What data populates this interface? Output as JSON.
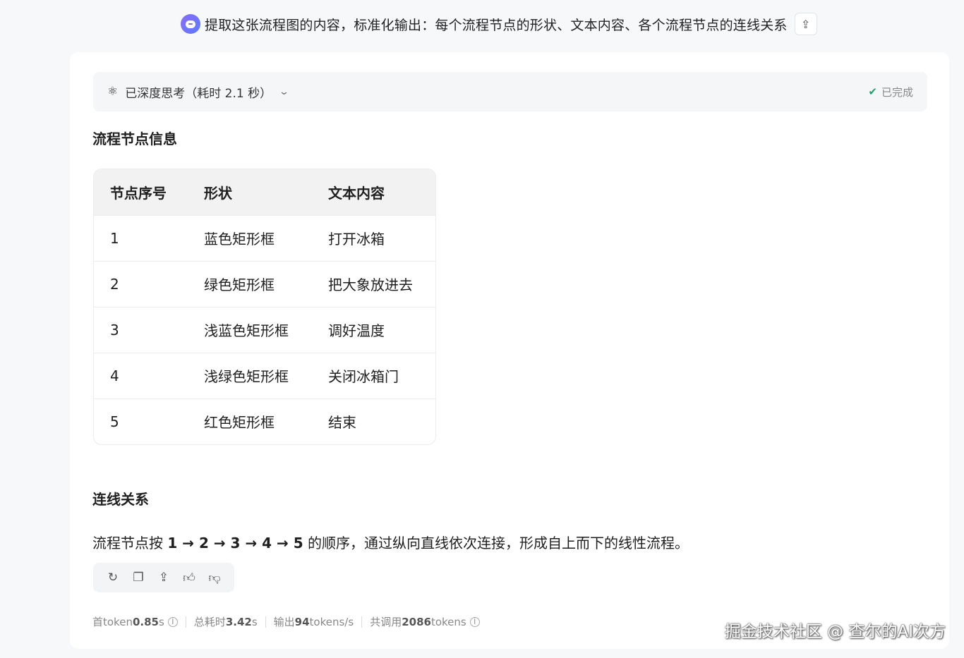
{
  "user_message": {
    "text": "提取这张流程图的内容，标准化输出：每个流程节点的形状、文本内容、各个流程节点的连线关系",
    "avatar_icon": "chat-bubble-icon",
    "share_icon": "share-icon"
  },
  "thinking": {
    "label": "已深度思考（耗时 2.1 秒）",
    "status": "已完成",
    "status_color": "#22a06b"
  },
  "nodes_section": {
    "title": "流程节点信息",
    "columns": [
      "节点序号",
      "形状",
      "文本内容"
    ],
    "rows": [
      [
        "1",
        "蓝色矩形框",
        "打开冰箱"
      ],
      [
        "2",
        "绿色矩形框",
        "把大象放进去"
      ],
      [
        "3",
        "浅蓝色矩形框",
        "调好温度"
      ],
      [
        "4",
        "浅绿色矩形框",
        "关闭冰箱门"
      ],
      [
        "5",
        "红色矩形框",
        "结束"
      ]
    ]
  },
  "links_section": {
    "title": "连线关系",
    "prefix": "流程节点按 ",
    "sequence": "1 → 2 → 3 → 4 → 5",
    "suffix": " 的顺序，通过纵向直线依次连接，形成自上而下的线性流程。"
  },
  "actions": [
    "refresh-icon",
    "copy-icon",
    "share-icon",
    "thumbs-up-icon",
    "thumbs-down-icon"
  ],
  "stats": {
    "first_token_label": "首token",
    "first_token_value": "0.85",
    "first_token_unit": " s",
    "total_label": "总耗时",
    "total_value": "3.42",
    "total_unit": " s",
    "output_label": "输出",
    "output_value": "94",
    "output_unit": " tokens/s",
    "calls_label": "共调用",
    "calls_value": "2086",
    "calls_unit": " tokens"
  },
  "watermark": "掘金技术社区 @ 查尔的AI次方"
}
